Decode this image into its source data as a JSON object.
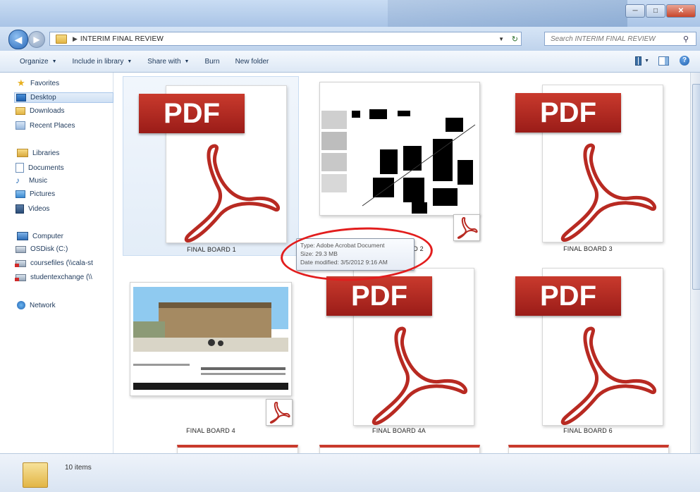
{
  "window": {
    "minimize": "─",
    "maximize": "□",
    "close": "✕"
  },
  "address": {
    "path": "INTERIM FINAL REVIEW"
  },
  "search": {
    "placeholder": "Search INTERIM FINAL REVIEW"
  },
  "toolbar": {
    "organize": "Organize",
    "include": "Include in library",
    "share": "Share with",
    "burn": "Burn",
    "new_folder": "New folder"
  },
  "navpane": {
    "favorites": "Favorites",
    "desktop": "Desktop",
    "downloads": "Downloads",
    "recent": "Recent Places",
    "libraries": "Libraries",
    "documents": "Documents",
    "music": "Music",
    "pictures": "Pictures",
    "videos": "Videos",
    "computer": "Computer",
    "osdisk": "OSDisk (C:)",
    "coursefiles": "coursefiles (\\\\cala-st",
    "studentexchange": "studentexchange (\\\\",
    "network": "Network"
  },
  "files": [
    {
      "name": "FINAL BOARD 1",
      "icon": "pdf-icon",
      "banner": "PDF"
    },
    {
      "name": "FINAL BOARD 2",
      "icon": "pdf-thumbnail"
    },
    {
      "name": "FINAL BOARD 3",
      "icon": "pdf-icon",
      "banner": "PDF"
    },
    {
      "name": "FINAL BOARD 4",
      "icon": "pdf-thumbnail"
    },
    {
      "name": "FINAL BOARD 4A",
      "icon": "pdf-icon",
      "banner": "PDF"
    },
    {
      "name": "FINAL BOARD 6",
      "icon": "pdf-icon",
      "banner": "PDF"
    }
  ],
  "tooltip": {
    "type": "Type: Adobe Acrobat Document",
    "size": "Size: 29.3 MB",
    "modified": "Date modified: 3/5/2012 9:16 AM"
  },
  "status": {
    "count": "10 items"
  },
  "colors": {
    "pdf_red": "#b82a22",
    "annotation_red": "#e21d1d",
    "selection_blue": "#cfe0f4"
  }
}
